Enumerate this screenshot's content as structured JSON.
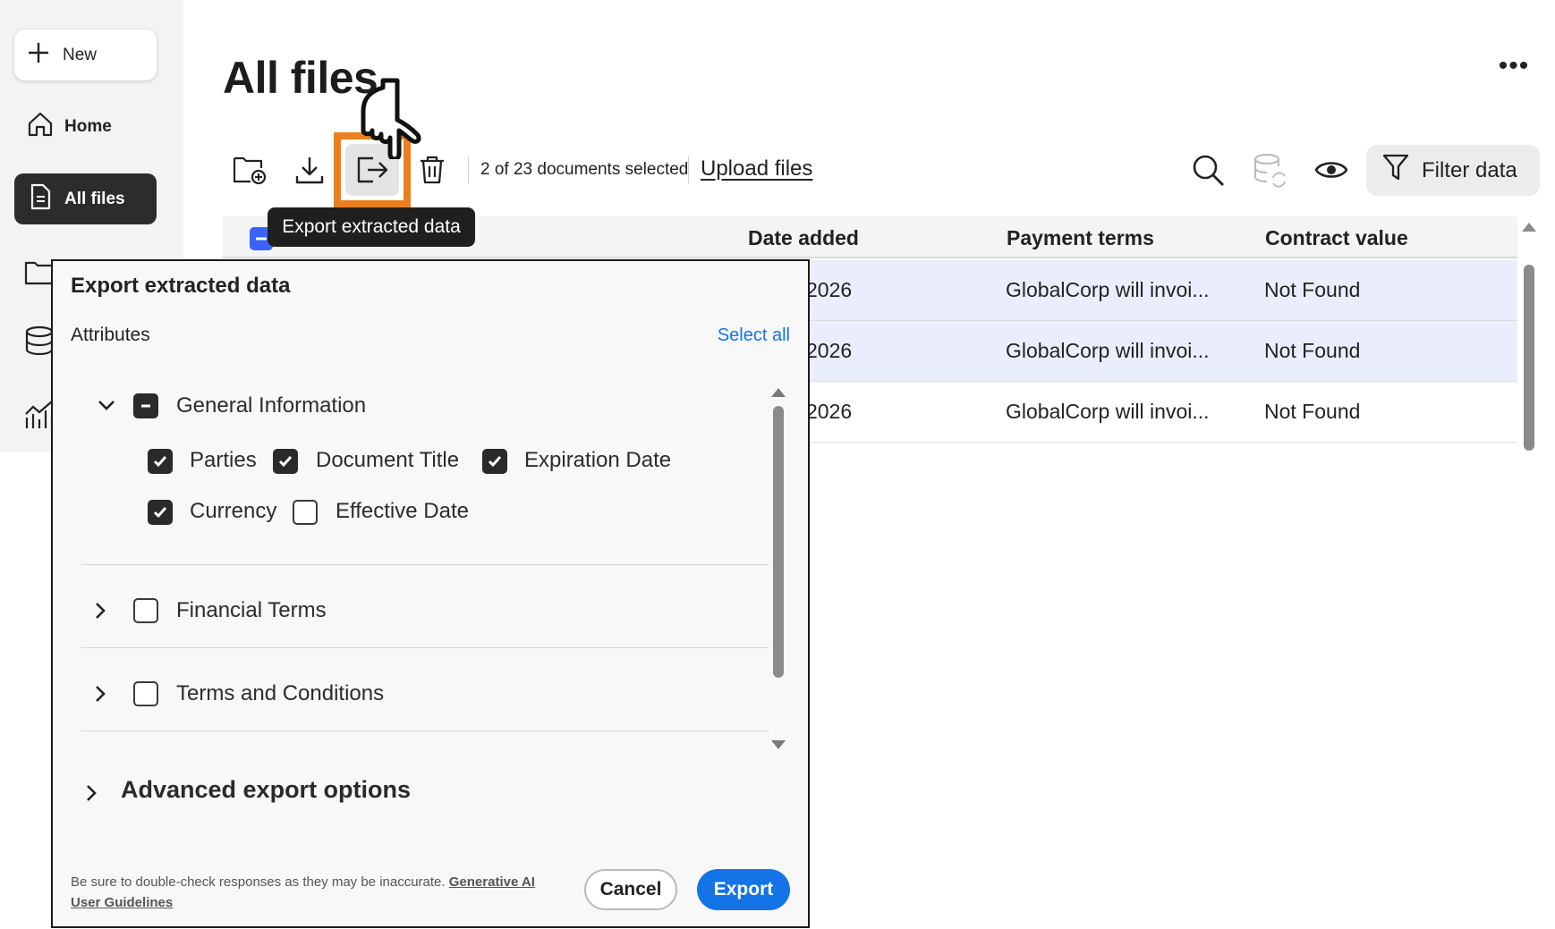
{
  "sidebar": {
    "new_label": "New",
    "items": [
      {
        "label": "Home",
        "icon": "home-icon"
      },
      {
        "label": "All files",
        "icon": "file-icon"
      },
      {
        "label": "",
        "icon": "folder-icon"
      },
      {
        "label": "",
        "icon": "database-icon"
      },
      {
        "label": "",
        "icon": "analytics-icon"
      }
    ]
  },
  "header": {
    "title": "All files",
    "more_label": "•••"
  },
  "toolbar": {
    "selection_text": "2 of 23 documents selected",
    "upload_label": "Upload files",
    "filter_label": "Filter data",
    "tooltip": "Export extracted data"
  },
  "table": {
    "columns": [
      "Date added",
      "Payment terms",
      "Contract value"
    ],
    "rows": [
      {
        "date": "2026",
        "payment": "GlobalCorp will invoi...",
        "value": "Not Found",
        "selected": true
      },
      {
        "date": "2026",
        "payment": "GlobalCorp will invoi...",
        "value": "Not Found",
        "selected": true
      },
      {
        "date": "2026",
        "payment": "GlobalCorp will invoi...",
        "value": "Not Found",
        "selected": false
      }
    ]
  },
  "dialog": {
    "title": "Export extracted data",
    "attributes_label": "Attributes",
    "select_all": "Select all",
    "groups": [
      {
        "label": "General Information",
        "state": "partial",
        "expanded": true,
        "items": [
          {
            "label": "Parties",
            "checked": true
          },
          {
            "label": "Document Title",
            "checked": true
          },
          {
            "label": "Expiration Date",
            "checked": true
          },
          {
            "label": "Currency",
            "checked": true
          },
          {
            "label": "Effective Date",
            "checked": false
          }
        ]
      },
      {
        "label": "Financial Terms",
        "state": "unchecked",
        "expanded": false
      },
      {
        "label": "Terms and Conditions",
        "state": "unchecked",
        "expanded": false
      }
    ],
    "advanced_label": "Advanced export options",
    "disclaimer": "Be sure to double-check responses as they may be inaccurate.",
    "disclaimer_link": "Generative AI User Guidelines",
    "cancel_label": "Cancel",
    "export_label": "Export"
  },
  "colors": {
    "accent": "#1473e6",
    "highlight": "#ec7f1c",
    "selected_row": "#eaeefc",
    "checkbox_header": "#3b63fb"
  }
}
